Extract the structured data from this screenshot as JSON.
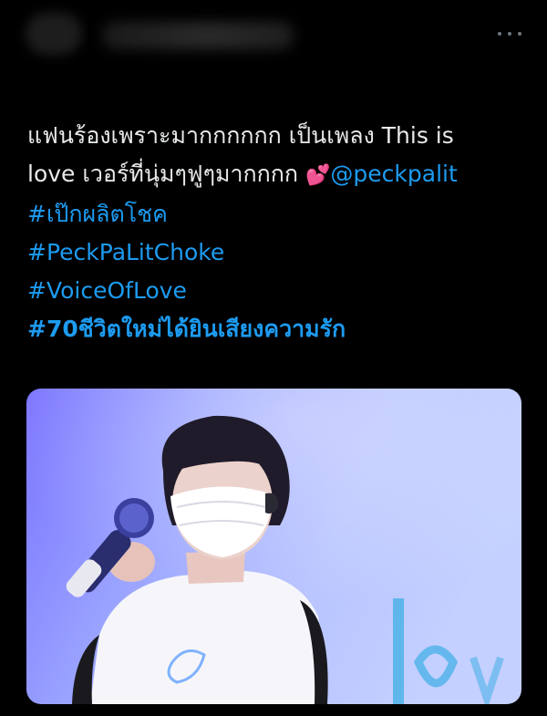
{
  "tweet": {
    "line1": "แฟนร้องเพราะมากกกกกก เป็นเพลง This is",
    "line2_text": "love เวอร์ที่นุ่มๆฟูๆมากกกก ",
    "line2_emoji": "💕",
    "mention": "@peckpalit",
    "hashtags": [
      "#เป๊กผลิตโชค",
      "#PeckPaLitChoke",
      "#VoiceOfLove"
    ],
    "hashtag_bold": "#70ชีวิตใหม่ได้ยินเสียงความรัก"
  },
  "icons": {
    "more": "more-horizontal-icon"
  },
  "colors": {
    "background": "#000000",
    "text": "#e7e9ea",
    "link": "#1d9bf0"
  }
}
